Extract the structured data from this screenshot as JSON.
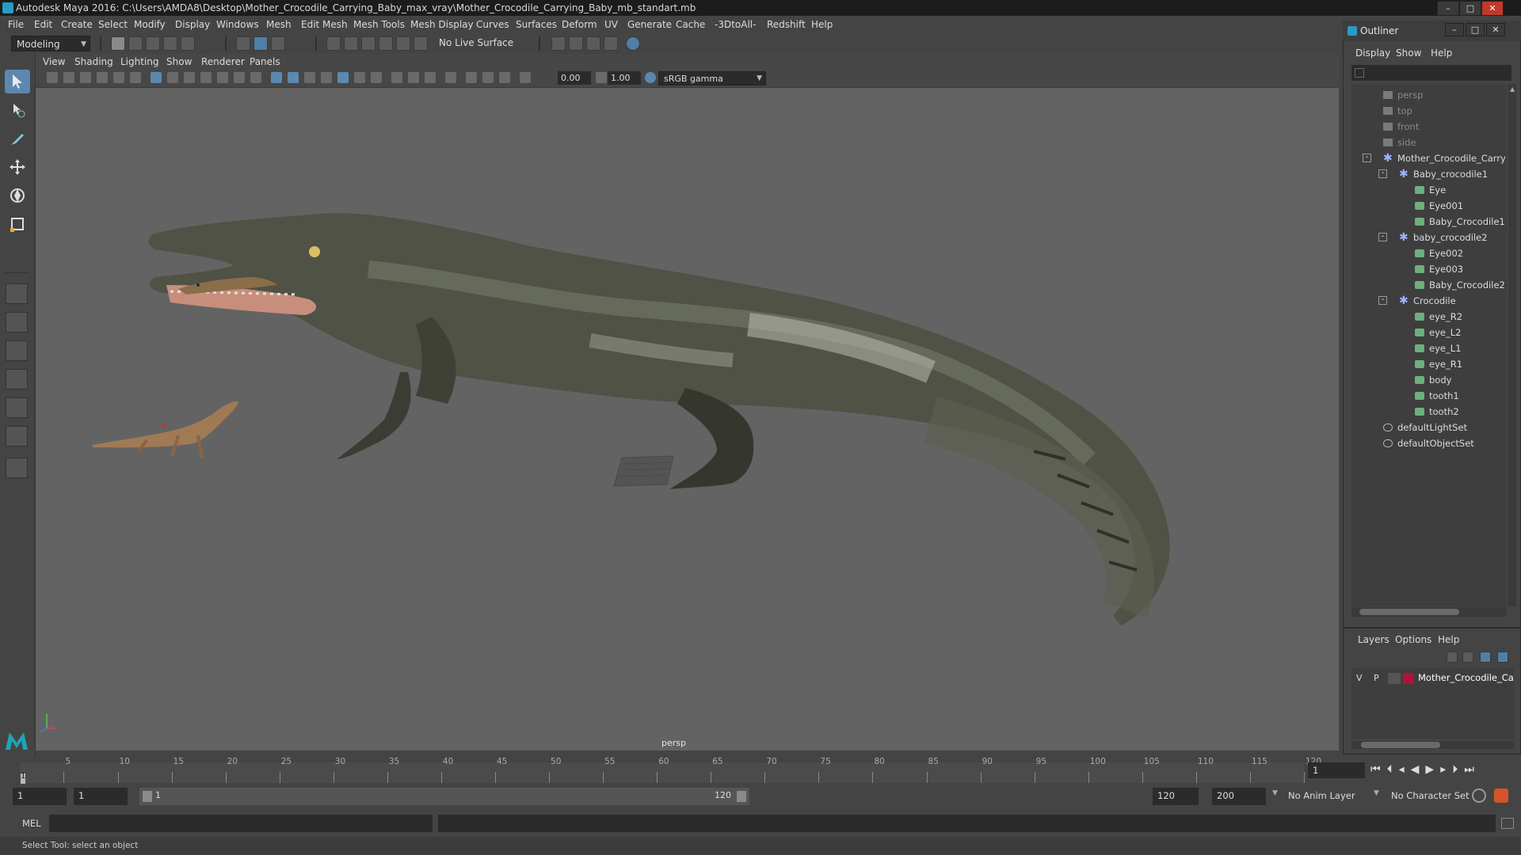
{
  "window": {
    "title": "Autodesk Maya 2016: C:\\Users\\AMDA8\\Desktop\\Mother_Crocodile_Carrying_Baby_max_vray\\Mother_Crocodile_Carrying_Baby_mb_standart.mb",
    "min": "–",
    "max": "□",
    "close": "✕"
  },
  "menubar": [
    "File",
    "Edit",
    "Create",
    "Select",
    "Modify",
    "Display",
    "Windows",
    "Mesh",
    "Edit Mesh",
    "Mesh Tools",
    "Mesh Display",
    "Curves",
    "Surfaces",
    "Deform",
    "UV",
    "Generate",
    "Cache",
    "-3DtoAll-",
    "Redshift",
    "Help"
  ],
  "shelf": {
    "mode": "Modeling",
    "live_surface": "No Live Surface"
  },
  "viewport": {
    "menus": [
      "View",
      "Shading",
      "Lighting",
      "Show",
      "Renderer",
      "Panels"
    ],
    "field1": "0.00",
    "field2": "1.00",
    "color_space": "sRGB gamma",
    "camera": "persp"
  },
  "outliner": {
    "title": "Outliner",
    "menus": [
      "Display",
      "Show",
      "Help"
    ],
    "rows": [
      {
        "label": "persp",
        "indent": 0,
        "dim": true,
        "icon": "camera-icon"
      },
      {
        "label": "top",
        "indent": 0,
        "dim": true,
        "icon": "camera-icon"
      },
      {
        "label": "front",
        "indent": 0,
        "dim": true,
        "icon": "camera-icon"
      },
      {
        "label": "side",
        "indent": 0,
        "dim": true,
        "icon": "camera-icon"
      },
      {
        "label": "Mother_Crocodile_Carrying_Baby",
        "indent": 0,
        "dim": false,
        "icon": "group-icon",
        "expand": "-"
      },
      {
        "label": "Baby_crocodile1",
        "indent": 1,
        "dim": false,
        "icon": "group-icon",
        "expand": "-"
      },
      {
        "label": "Eye",
        "indent": 2,
        "dim": false,
        "icon": "mesh-icon"
      },
      {
        "label": "Eye001",
        "indent": 2,
        "dim": false,
        "icon": "mesh-icon"
      },
      {
        "label": "Baby_Crocodile1",
        "indent": 2,
        "dim": false,
        "icon": "mesh-icon"
      },
      {
        "label": "baby_crocodile2",
        "indent": 1,
        "dim": false,
        "icon": "group-icon",
        "expand": "-"
      },
      {
        "label": "Eye002",
        "indent": 2,
        "dim": false,
        "icon": "mesh-icon"
      },
      {
        "label": "Eye003",
        "indent": 2,
        "dim": false,
        "icon": "mesh-icon"
      },
      {
        "label": "Baby_Crocodile2",
        "indent": 2,
        "dim": false,
        "icon": "mesh-icon"
      },
      {
        "label": "Crocodile",
        "indent": 1,
        "dim": false,
        "icon": "group-icon",
        "expand": "-"
      },
      {
        "label": "eye_R2",
        "indent": 2,
        "dim": false,
        "icon": "mesh-icon"
      },
      {
        "label": "eye_L2",
        "indent": 2,
        "dim": false,
        "icon": "mesh-icon"
      },
      {
        "label": "eye_L1",
        "indent": 2,
        "dim": false,
        "icon": "mesh-icon"
      },
      {
        "label": "eye_R1",
        "indent": 2,
        "dim": false,
        "icon": "mesh-icon"
      },
      {
        "label": "body",
        "indent": 2,
        "dim": false,
        "icon": "mesh-icon"
      },
      {
        "label": "tooth1",
        "indent": 2,
        "dim": false,
        "icon": "mesh-icon"
      },
      {
        "label": "tooth2",
        "indent": 2,
        "dim": false,
        "icon": "mesh-icon"
      },
      {
        "label": "defaultLightSet",
        "indent": 0,
        "dim": false,
        "icon": "set-icon"
      },
      {
        "label": "defaultObjectSet",
        "indent": 0,
        "dim": false,
        "icon": "set-icon"
      }
    ]
  },
  "layers": {
    "menus": [
      "Layers",
      "Options",
      "Help"
    ],
    "layer": {
      "v": "V",
      "p": "P",
      "name": "Mother_Crocodile_Carrying_Baby",
      "color": "#b0123a"
    }
  },
  "timeline": {
    "ticks": [
      "5",
      "10",
      "15",
      "20",
      "25",
      "30",
      "35",
      "40",
      "45",
      "50",
      "55",
      "60",
      "65",
      "70",
      "75",
      "80",
      "85",
      "90",
      "95",
      "100",
      "105",
      "110",
      "115",
      "120"
    ],
    "current_marker": "1",
    "current_frame": "1"
  },
  "range": {
    "start": "1",
    "inner_start": "1",
    "slider_start": "1",
    "slider_end": "120",
    "end": "120",
    "anim_end": "200",
    "anim_layer": "No Anim Layer",
    "char_set": "No Character Set"
  },
  "mel": {
    "label": "MEL"
  },
  "help": "Select Tool: select an object",
  "colors": {
    "accent": "#5c88b0",
    "viewport_bg": "#636363",
    "panel_bg": "#444444"
  }
}
